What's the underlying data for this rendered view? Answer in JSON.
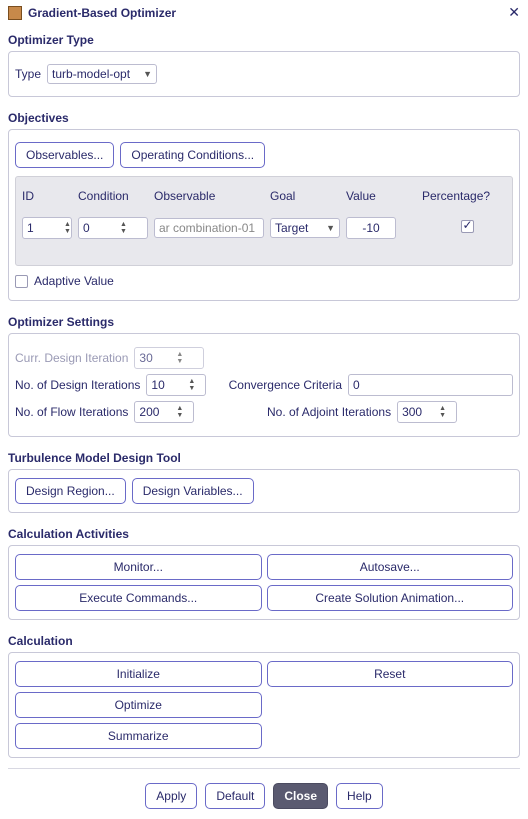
{
  "window": {
    "title": "Gradient-Based Optimizer"
  },
  "optimizer_type": {
    "section": "Optimizer Type",
    "type_label": "Type",
    "type_value": "turb-model-opt"
  },
  "objectives": {
    "section": "Objectives",
    "btn_observables": "Observables...",
    "btn_opconds": "Operating Conditions...",
    "headers": {
      "id": "ID",
      "condition": "Condition",
      "observable": "Observable",
      "goal": "Goal",
      "value": "Value",
      "percentage": "Percentage?"
    },
    "row": {
      "id": "1",
      "condition": "0",
      "observable": "ar combination-01",
      "goal": "Target",
      "value": "-10",
      "percentage_checked": true
    },
    "adaptive_label": "Adaptive Value"
  },
  "settings": {
    "section": "Optimizer Settings",
    "curr_design_iter_label": "Curr. Design Iteration",
    "curr_design_iter": "30",
    "no_design_iter_label": "No. of Design Iterations",
    "no_design_iter": "10",
    "conv_crit_label": "Convergence Criteria",
    "conv_crit": "0",
    "no_flow_iter_label": "No. of Flow Iterations",
    "no_flow_iter": "200",
    "no_adjoint_iter_label": "No. of Adjoint Iterations",
    "no_adjoint_iter": "300"
  },
  "turbulence": {
    "section": "Turbulence Model Design Tool",
    "btn_region": "Design Region...",
    "btn_vars": "Design Variables..."
  },
  "activities": {
    "section": "Calculation Activities",
    "btn_monitor": "Monitor...",
    "btn_autosave": "Autosave...",
    "btn_exec": "Execute Commands...",
    "btn_anim": "Create Solution Animation..."
  },
  "calculation": {
    "section": "Calculation",
    "btn_init": "Initialize",
    "btn_reset": "Reset",
    "btn_opt": "Optimize",
    "btn_sum": "Summarize"
  },
  "footer": {
    "apply": "Apply",
    "default": "Default",
    "close": "Close",
    "help": "Help"
  }
}
